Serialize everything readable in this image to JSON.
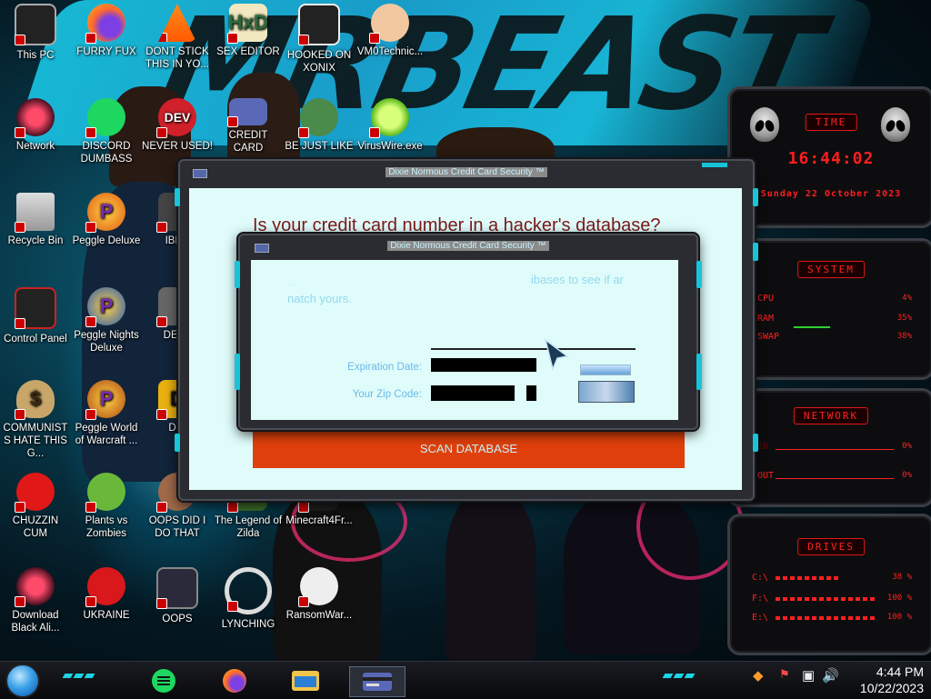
{
  "desktop_icons": [
    {
      "label": "This PC",
      "icon": "computer-icon"
    },
    {
      "label": "FURRY FUX",
      "icon": "firefox-icon"
    },
    {
      "label": "DONT STICK THIS IN YO...",
      "icon": "vlc-cone-icon"
    },
    {
      "label": "SEX EDITOR",
      "icon": "hxd-editor-icon"
    },
    {
      "label": "HOOKED ON XONIX",
      "icon": "xonix-game-icon"
    },
    {
      "label": "VM0Technic...",
      "icon": "doctor-icon"
    },
    {
      "label": "Network",
      "icon": "alien-network-icon"
    },
    {
      "label": "DISCORD DUMBASS",
      "icon": "chat-app-icon"
    },
    {
      "label": "NEVER USED!",
      "icon": "dev-cpp-icon"
    },
    {
      "label": "CREDIT CARD",
      "icon": "credit-card-icon"
    },
    {
      "label": "BE JUST LIKE",
      "icon": "santa-face-icon"
    },
    {
      "label": "VirusWire.exe",
      "icon": "lime-icon"
    },
    {
      "label": "Recycle Bin",
      "icon": "recycle-bin-icon"
    },
    {
      "label": "Peggle Deluxe",
      "icon": "peggle-icon"
    },
    {
      "label": "IBRA",
      "icon": "app-icon"
    },
    {
      "label": "Control Panel",
      "icon": "control-panel-icon"
    },
    {
      "label": "Peggle Nights Deluxe",
      "icon": "peggle-nights-icon"
    },
    {
      "label": "DEEZ",
      "icon": "printer-icon"
    },
    {
      "label": "COMMUNISTS HATE THIS G...",
      "icon": "money-bag-icon"
    },
    {
      "label": "Peggle World of Warcraft ...",
      "icon": "peggle-wow-icon"
    },
    {
      "label": "DIE",
      "icon": "d-app-icon"
    },
    {
      "label": "CHUZZIN CUM",
      "icon": "chuzzle-icon"
    },
    {
      "label": "Plants vs Zombies",
      "icon": "plants-icon"
    },
    {
      "label": "OOPS DID I DO THAT",
      "icon": "person-icon"
    },
    {
      "label": "The Legend of Zilda",
      "icon": "zelda-icon"
    },
    {
      "label": "Minecraft4Fr...",
      "icon": "minecraft-icon"
    },
    {
      "label": "Download Black Ali...",
      "icon": "alien-download-icon"
    },
    {
      "label": "UKRAINE",
      "icon": "radiation-icon"
    },
    {
      "label": "OOPS",
      "icon": "oops-app-icon"
    },
    {
      "label": "LYNCHING",
      "icon": "rope-icon"
    },
    {
      "label": "RansomWar...",
      "icon": "skull-icon"
    }
  ],
  "back_window": {
    "title": "Dixie Normous Credit Card Security ™",
    "heading": "Is your credit card number in a hacker's database?",
    "scan_button": "SCAN DATABASE"
  },
  "front_window": {
    "title": "Dixie Normous Credit Card Security ™",
    "text_line1_left": "...",
    "text_line1_right": "ibases to see if ar",
    "text_line2": "natch yours.",
    "expiration_label": "Expiration Date:",
    "zip_label": "Your Zip Code:"
  },
  "gadgets": {
    "time": {
      "header": "TIME",
      "clock": "16:44:02",
      "date": "Sunday 22 October 2023"
    },
    "system": {
      "header": "SYSTEM",
      "rows": [
        {
          "label": "CPU",
          "value": "4%"
        },
        {
          "label": "RAM",
          "value": "35%"
        },
        {
          "label": "SWAP",
          "value": "38%"
        }
      ]
    },
    "network": {
      "header": "NETWORK",
      "rows": [
        {
          "label": "IN",
          "value": "0%"
        },
        {
          "label": "OUT",
          "value": "0%"
        }
      ]
    },
    "drives": {
      "header": "DRIVES",
      "rows": [
        {
          "label": "C:\\",
          "value": "38 %"
        },
        {
          "label": "F:\\",
          "value": "100 %"
        },
        {
          "label": "E:\\",
          "value": "100 %"
        }
      ]
    }
  },
  "taskbar": {
    "apps": [
      "chat-app-icon",
      "firefox-icon",
      "file-explorer-icon",
      "credit-card-icon"
    ],
    "tray_icons": [
      "app-tray-icon",
      "network-warning-icon",
      "network-icon",
      "volume-icon"
    ],
    "time": "4:44 PM",
    "date": "10/22/2023"
  },
  "colors": {
    "accent_cyan": "#17c4d8",
    "gadget_red": "#ff2020",
    "scan_button": "#e0400b",
    "client_bg": "#dffcfb"
  }
}
